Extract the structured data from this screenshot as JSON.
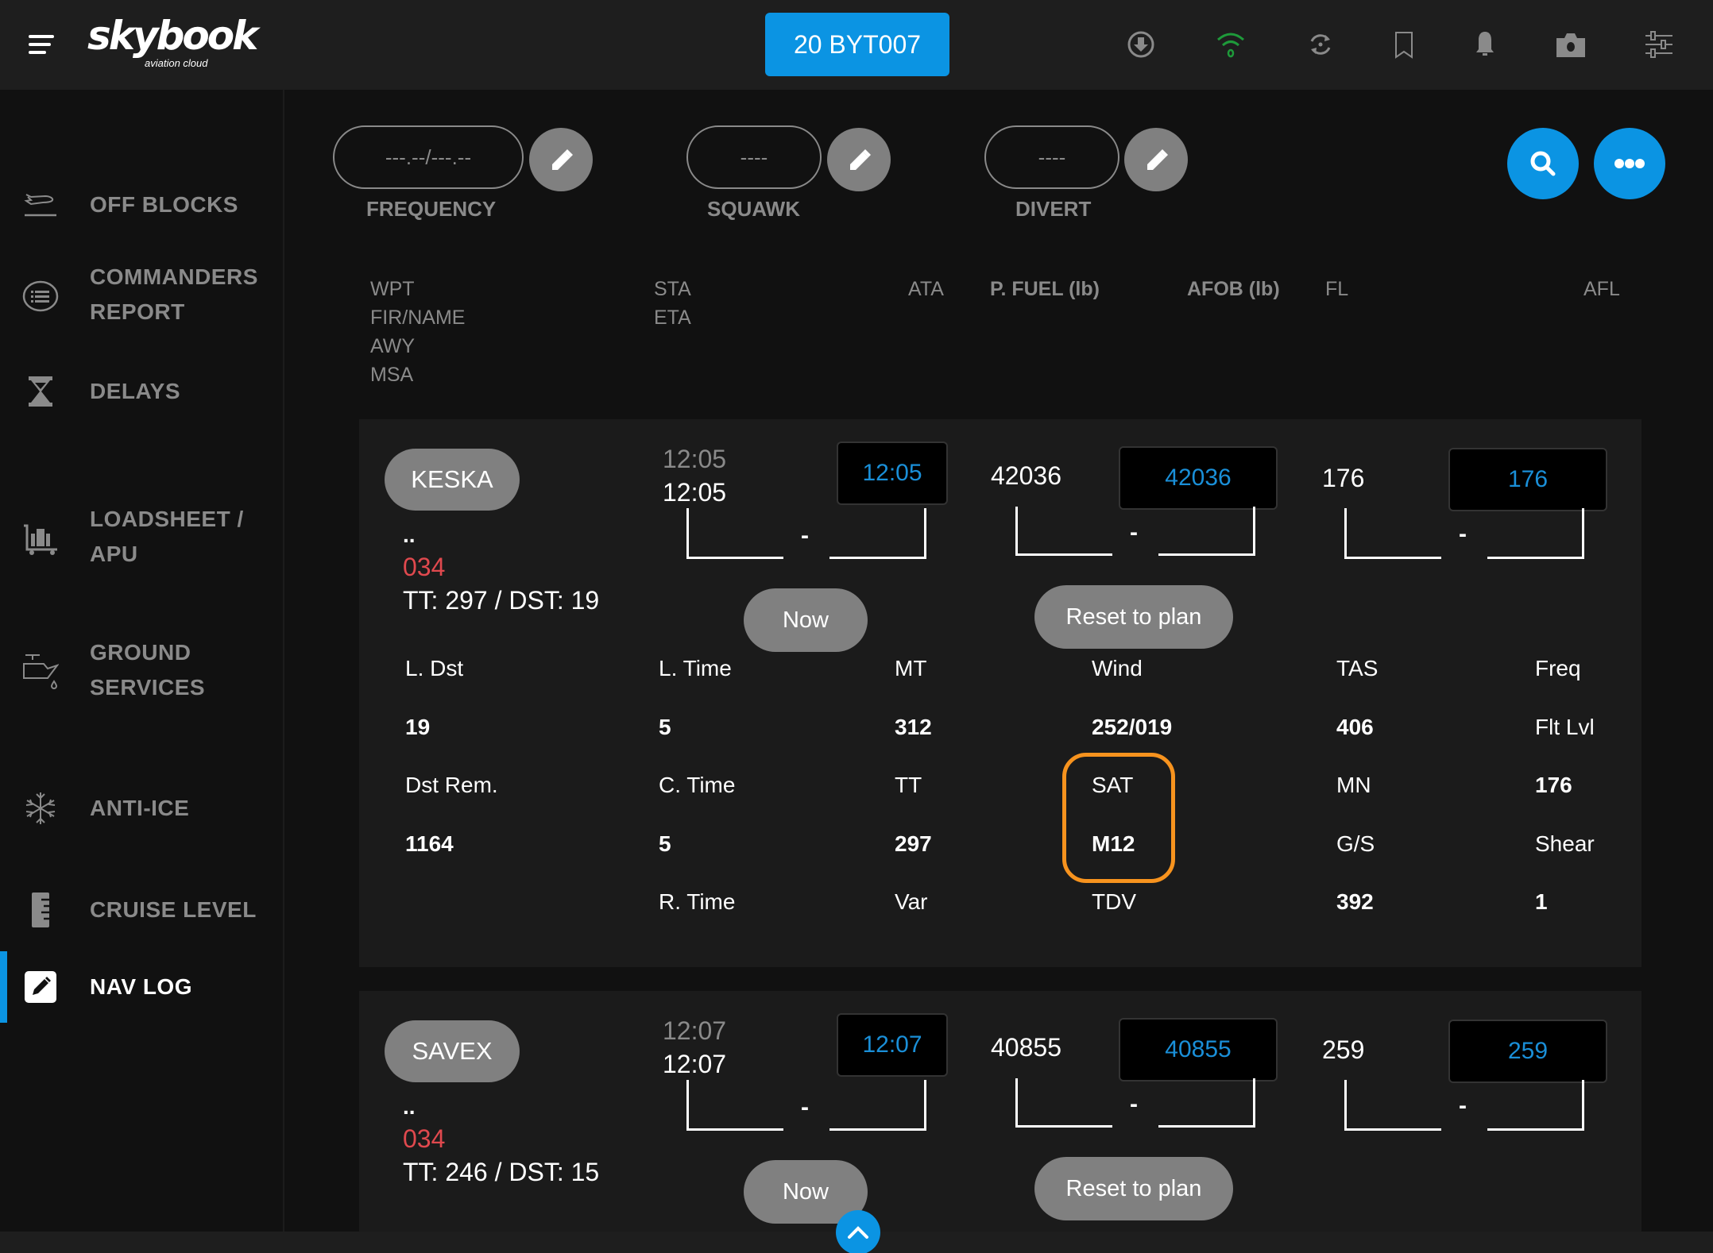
{
  "app": {
    "logo_text": "skybook",
    "logo_subtext": "aviation cloud",
    "flight_button": "20 BYT007"
  },
  "top_icons": [
    {
      "name": "download-icon",
      "color": "#8a8a8a"
    },
    {
      "name": "wifi-icon",
      "color": "#1e9a3a"
    },
    {
      "name": "sync-icon",
      "color": "#8a8a8a"
    },
    {
      "name": "bookmark-icon",
      "color": "#8a8a8a"
    },
    {
      "name": "bell-icon",
      "color": "#8a8a8a"
    },
    {
      "name": "camera-icon",
      "color": "#8a8a8a"
    },
    {
      "name": "sliders-icon",
      "color": "#8a8a8a"
    }
  ],
  "sidebar": {
    "items": [
      {
        "label": "OFF BLOCKS",
        "icon": "takeoff-icon"
      },
      {
        "label": "COMMANDERS\nREPORT",
        "line1": "COMMANDERS",
        "line2": "REPORT",
        "icon": "list-icon"
      },
      {
        "label": "DELAYS",
        "icon": "hourglass-icon"
      },
      {
        "label": "LOADSHEET /\nAPU",
        "line1": "LOADSHEET /",
        "line2": "APU",
        "icon": "luggage-cart-icon"
      },
      {
        "label": "GROUND\nSERVICES",
        "line1": "GROUND",
        "line2": "SERVICES",
        "icon": "fuel-service-icon"
      },
      {
        "label": "ANTI-ICE",
        "icon": "snowflake-icon"
      },
      {
        "label": "CRUISE LEVEL",
        "icon": "ruler-icon"
      },
      {
        "label": "NAV LOG",
        "icon": "edit-icon",
        "active": true
      }
    ]
  },
  "fields": {
    "frequency": {
      "label": "FREQUENCY",
      "placeholder": "---.--/---.--"
    },
    "squawk": {
      "label": "SQUAWK",
      "placeholder": "----"
    },
    "divert": {
      "label": "DIVERT",
      "placeholder": "----"
    }
  },
  "headers": {
    "wpt": "WPT",
    "fir": "FIR/NAME",
    "awy": "AWY",
    "msa": "MSA",
    "sta": "STA",
    "eta": "ETA",
    "ata": "ATA",
    "pfuel": "P. FUEL (lb)",
    "afob": "AFOB (lb)",
    "fl": "FL",
    "afl": "AFL"
  },
  "buttons": {
    "now": "Now",
    "reset": "Reset to plan",
    "dash": "-"
  },
  "waypoints": [
    {
      "name": "KESKA",
      "fir": "..",
      "awy": "034",
      "summary": "TT: 297 / DST: 19",
      "sta": "12:05",
      "eta": "12:05",
      "ata": "12:05",
      "pfuel": "42036",
      "afob": "42036",
      "fl": "176",
      "afl": "176",
      "details": {
        "l_dst_label": "L. Dst",
        "l_dst": "19",
        "dst_rem_label": "Dst Rem.",
        "dst_rem": "1164",
        "l_time_label": "L. Time",
        "l_time": "5",
        "c_time_label": "C. Time",
        "c_time": "5",
        "r_time_label": "R. Time",
        "mt_label": "MT",
        "mt": "312",
        "tt_label": "TT",
        "tt": "297",
        "var_label": "Var",
        "wind_label": "Wind",
        "wind": "252/019",
        "sat_label": "SAT",
        "sat": "M12",
        "tdv_label": "TDV",
        "tas_label": "TAS",
        "tas": "406",
        "mn_label": "MN",
        "gs_label": "G/S",
        "gs": "392",
        "freq_label": "Freq",
        "flt_lvl_label": "Flt Lvl",
        "flt_lvl": "176",
        "shear_label": "Shear",
        "shear": "1"
      }
    },
    {
      "name": "SAVEX",
      "fir": "..",
      "awy": "034",
      "summary": "TT: 246 / DST: 15",
      "sta": "12:07",
      "eta": "12:07",
      "ata": "12:07",
      "pfuel": "40855",
      "afob": "40855",
      "fl": "259",
      "afl": "259"
    }
  ],
  "colors": {
    "accent": "#0b94e3",
    "highlight": "#f7931e",
    "awy_red": "#e0494e",
    "value_blue": "#1a8fd8"
  }
}
